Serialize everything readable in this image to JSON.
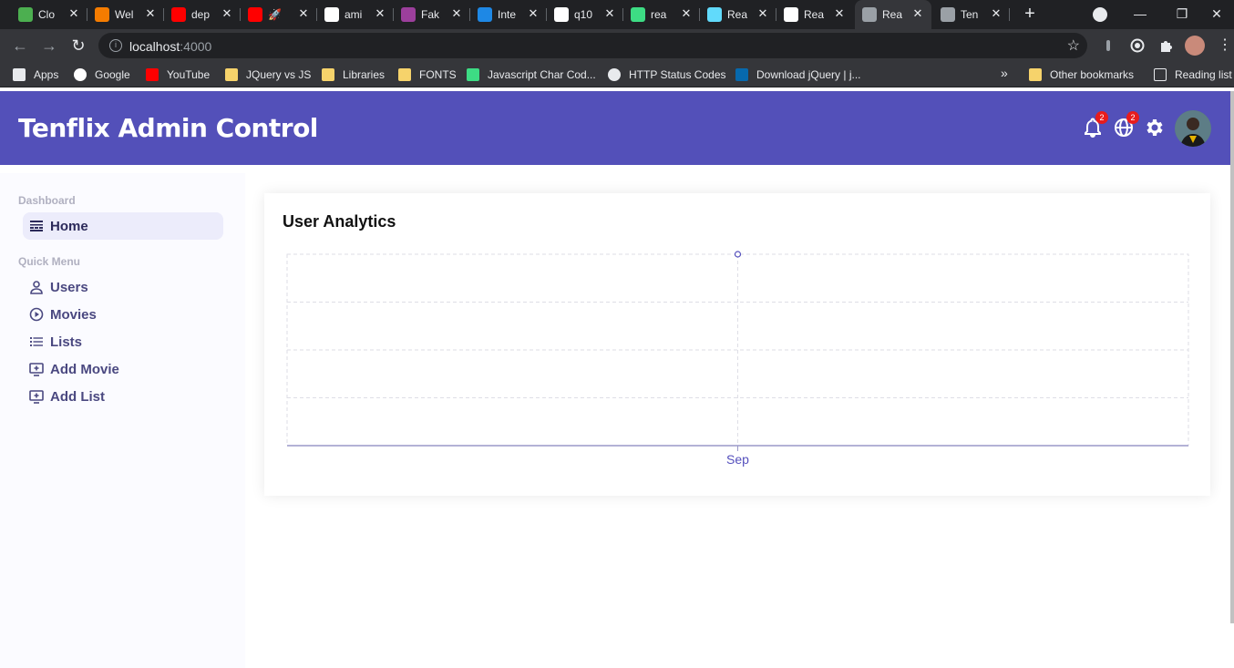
{
  "browser": {
    "tabs": [
      {
        "label": "Clo",
        "color": "#4caf50"
      },
      {
        "label": "Wel",
        "color": "#f57c00"
      },
      {
        "label": "dep",
        "color": "#ff0000"
      },
      {
        "label": "🚀",
        "color": "#ff0000"
      },
      {
        "label": "ami",
        "color": "#ffffff"
      },
      {
        "label": "Fak",
        "color": "#9c3f9c"
      },
      {
        "label": "Inte",
        "color": "#1e88e5"
      },
      {
        "label": "q10",
        "color": "#ffffff"
      },
      {
        "label": "rea",
        "color": "#3ddc84"
      },
      {
        "label": "Rea",
        "color": "#61dafb"
      },
      {
        "label": "Rea",
        "color": "#ffffff"
      },
      {
        "label": "Rea",
        "color": "#9aa0a6"
      },
      {
        "label": "Ten",
        "color": "#9aa0a6"
      }
    ],
    "active_tab_index": 11,
    "url_host": "localhost",
    "url_port": ":4000",
    "bookmarks": [
      {
        "label": "Apps",
        "icon": "apps-grid-icon"
      },
      {
        "label": "Google",
        "icon": "google-icon"
      },
      {
        "label": "YouTube",
        "icon": "youtube-icon"
      },
      {
        "label": "JQuery vs JS",
        "icon": "folder-icon"
      },
      {
        "label": "Libraries",
        "icon": "folder-icon"
      },
      {
        "label": "FONTS",
        "icon": "folder-icon"
      },
      {
        "label": "Javascript Char Cod...",
        "icon": "cr-icon"
      },
      {
        "label": "HTTP Status Codes",
        "icon": "globe-icon"
      },
      {
        "label": "Download jQuery | j...",
        "icon": "jquery-icon"
      }
    ],
    "overflow": "»",
    "other_bookmarks": "Other bookmarks",
    "reading_list": "Reading list"
  },
  "app": {
    "title": "Tenflix Admin Control",
    "notifications_badge": "2",
    "language_badge": "2",
    "accent_color": "#5350b9"
  },
  "sidebar": {
    "groups": [
      {
        "title": "Dashboard",
        "items": [
          {
            "label": "Home",
            "icon": "timeline-icon",
            "active": true
          }
        ]
      },
      {
        "title": "Quick Menu",
        "items": [
          {
            "label": "Users",
            "icon": "user-icon"
          },
          {
            "label": "Movies",
            "icon": "play-circle-icon"
          },
          {
            "label": "Lists",
            "icon": "list-icon"
          },
          {
            "label": "Add Movie",
            "icon": "add-screen-icon"
          },
          {
            "label": "Add List",
            "icon": "add-screen-icon"
          }
        ]
      }
    ]
  },
  "analytics": {
    "title": "User Analytics"
  },
  "chart_data": {
    "type": "line",
    "title": "User Analytics",
    "categories": [
      "Sep"
    ],
    "series": [
      {
        "values": [
          0
        ]
      }
    ],
    "grid": true,
    "color": "#5550bd"
  }
}
